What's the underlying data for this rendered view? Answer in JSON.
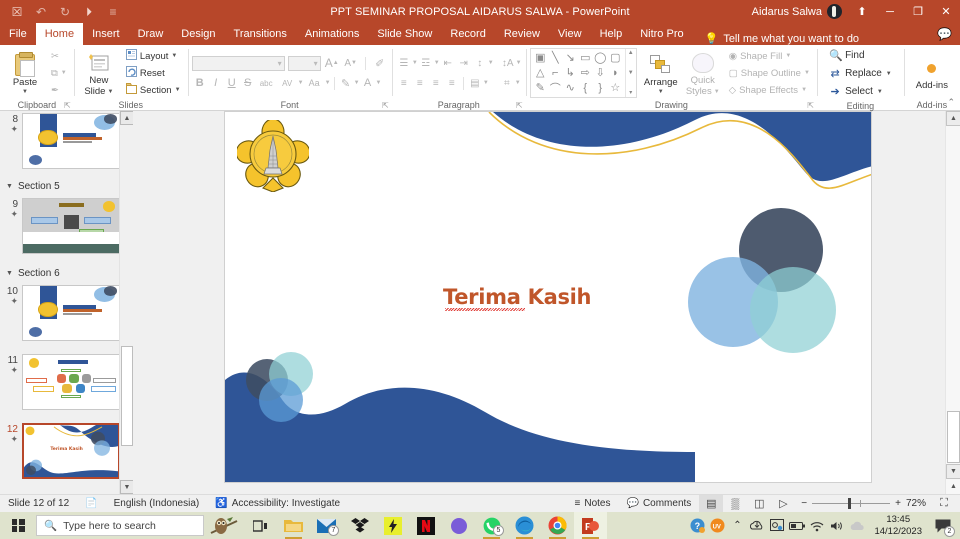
{
  "titlebar": {
    "document_title": "PPT SEMINAR PROPOSAL AIDARUS SALWA  -  PowerPoint",
    "account_name": "Aidarus Salwa",
    "qat": [
      {
        "name": "save-icon",
        "glyph": "☒"
      },
      {
        "name": "undo-icon",
        "glyph": "↶"
      },
      {
        "name": "redo-icon",
        "glyph": "↻"
      },
      {
        "name": "start-presentation-icon",
        "glyph": "⏵"
      },
      {
        "name": "customize-qat-icon",
        "glyph": "≡"
      }
    ],
    "window_controls": {
      "ribbon_display": "⬆",
      "minimize": "─",
      "restore": "❐",
      "close": "✕"
    }
  },
  "tabs": [
    {
      "label": "File",
      "active": false
    },
    {
      "label": "Home",
      "active": true
    },
    {
      "label": "Insert",
      "active": false
    },
    {
      "label": "Draw",
      "active": false
    },
    {
      "label": "Design",
      "active": false
    },
    {
      "label": "Transitions",
      "active": false
    },
    {
      "label": "Animations",
      "active": false
    },
    {
      "label": "Slide Show",
      "active": false
    },
    {
      "label": "Record",
      "active": false
    },
    {
      "label": "Review",
      "active": false
    },
    {
      "label": "View",
      "active": false
    },
    {
      "label": "Help",
      "active": false
    },
    {
      "label": "Nitro Pro",
      "active": false
    }
  ],
  "tell_me": "Tell me what you want to do",
  "ribbon": {
    "clipboard": {
      "label": "Clipboard",
      "paste": "Paste",
      "cut": "✂",
      "copy": "⧉",
      "format_painter": "✒"
    },
    "slides": {
      "label": "Slides",
      "new_slide": "New\nSlide",
      "new_slide_line1": "New",
      "new_slide_line2": "Slide",
      "layout": "Layout",
      "reset": "Reset",
      "section": "Section"
    },
    "font": {
      "label": "Font",
      "font_name_value": "",
      "font_size_value": "",
      "grow_font": "A",
      "shrink_font": "A",
      "clear_formatting": "✐",
      "bold": "B",
      "italic": "I",
      "underline": "U",
      "strikethrough": "S",
      "text_shadow": "abc",
      "character_spacing": "AV",
      "change_case": "Aa",
      "highlight": "✎",
      "font_color": "A"
    },
    "paragraph": {
      "label": "Paragraph",
      "bullets": "☰",
      "numbering": "☲",
      "decrease_indent": "⇤",
      "increase_indent": "⇥",
      "line_spacing": "↕",
      "text_direction": "↕A",
      "align_text": "⌗",
      "smartart": "▦",
      "align_left": "≡",
      "center": "≡",
      "align_right": "≡",
      "justify": "≡",
      "columns": "▤"
    },
    "drawing": {
      "label": "Drawing",
      "shapes": [
        "▣",
        "╲",
        "↘",
        "▭",
        "◯",
        "▢",
        "△",
        "⌐",
        "↳",
        "⇨",
        "⇩",
        "◗",
        "✎",
        "⌒",
        "∿",
        "{",
        "}",
        "☆"
      ],
      "arrange": "Arrange",
      "quick_styles_line1": "Quick",
      "quick_styles_line2": "Styles",
      "shape_fill": "Shape Fill",
      "shape_outline": "Shape Outline",
      "shape_effects": "Shape Effects"
    },
    "editing": {
      "label": "Editing",
      "find": "Find",
      "replace": "Replace",
      "select": "Select"
    },
    "addins": {
      "label": "Add-ins",
      "button": "Add-ins"
    },
    "collapse_ribbon": "⌃"
  },
  "thumbnails": [
    {
      "number": "8",
      "type": "chapter",
      "selected": false,
      "title": "BAB II Tinjauan Pustaka"
    },
    {
      "number": "9",
      "type": "diagram",
      "selected": false,
      "title": ""
    },
    {
      "number": "10",
      "type": "chapter",
      "selected": false,
      "title": "BAB III METODOLOGI PENELITIAN"
    },
    {
      "number": "11",
      "type": "process",
      "selected": false,
      "title": "Metode Penelitian"
    },
    {
      "number": "12",
      "type": "thanks",
      "selected": true,
      "title": "Terima Kasih"
    }
  ],
  "sections": [
    {
      "label": "Section 5"
    },
    {
      "label": "Section 6"
    }
  ],
  "slide": {
    "title": "Terima Kasih",
    "title_color": "#c0562a",
    "accent_blue": "#2f5597",
    "accent_gold": "#e8b93c",
    "circle_slate": "#3f4d63",
    "circle_blue": "#7fb3e0",
    "circle_teal": "#8fd0d4"
  },
  "statusbar": {
    "slide_counter": "Slide 12 of 12",
    "language": "English (Indonesia)",
    "accessibility": "Accessibility: Investigate",
    "notes": "Notes",
    "comments": "Comments",
    "zoom_level": "72%",
    "views": [
      {
        "name": "normal-view",
        "glyph": "▤",
        "active": true
      },
      {
        "name": "slide-sorter-view",
        "glyph": "▒",
        "active": false
      },
      {
        "name": "reading-view",
        "glyph": "◫",
        "active": false
      },
      {
        "name": "slide-show-view",
        "glyph": "▷",
        "active": false
      }
    ],
    "zoom_out": "−",
    "zoom_in": "+",
    "fit_to_window": "⛶"
  },
  "taskbar": {
    "search_placeholder": "Type here to search",
    "time": "13:45",
    "date": "14/12/2023",
    "apps": [
      {
        "name": "task-view-icon",
        "glyph": "⬚"
      },
      {
        "name": "file-explorer-icon",
        "glyph": "▰"
      },
      {
        "name": "mail-icon",
        "glyph": "✉",
        "badge": "7"
      },
      {
        "name": "dropbox-icon",
        "glyph": "❖"
      },
      {
        "name": "lightning-app-icon",
        "glyph": "⚡"
      },
      {
        "name": "netflix-icon",
        "glyph": "N"
      },
      {
        "name": "edge-copilot-icon",
        "glyph": "◑"
      },
      {
        "name": "whatsapp-icon",
        "glyph": "✆",
        "badge": "5"
      },
      {
        "name": "edge-icon",
        "glyph": "◎"
      },
      {
        "name": "chrome-icon",
        "glyph": "◉"
      },
      {
        "name": "powerpoint-icon",
        "glyph": "P"
      }
    ],
    "tray": [
      {
        "name": "help-icon",
        "glyph": "?"
      },
      {
        "name": "uv-icon",
        "glyph": "UV"
      },
      {
        "name": "show-hidden-icons",
        "glyph": "⌃"
      },
      {
        "name": "onedrive-sync-icon",
        "glyph": "☁"
      },
      {
        "name": "screen-capture-icon",
        "glyph": "▣"
      },
      {
        "name": "battery-icon",
        "glyph": "▭"
      },
      {
        "name": "wifi-icon",
        "glyph": "◠"
      },
      {
        "name": "volume-icon",
        "glyph": "◂"
      },
      {
        "name": "cloud-icon",
        "glyph": "☁"
      }
    ],
    "notification_badge": "2"
  }
}
